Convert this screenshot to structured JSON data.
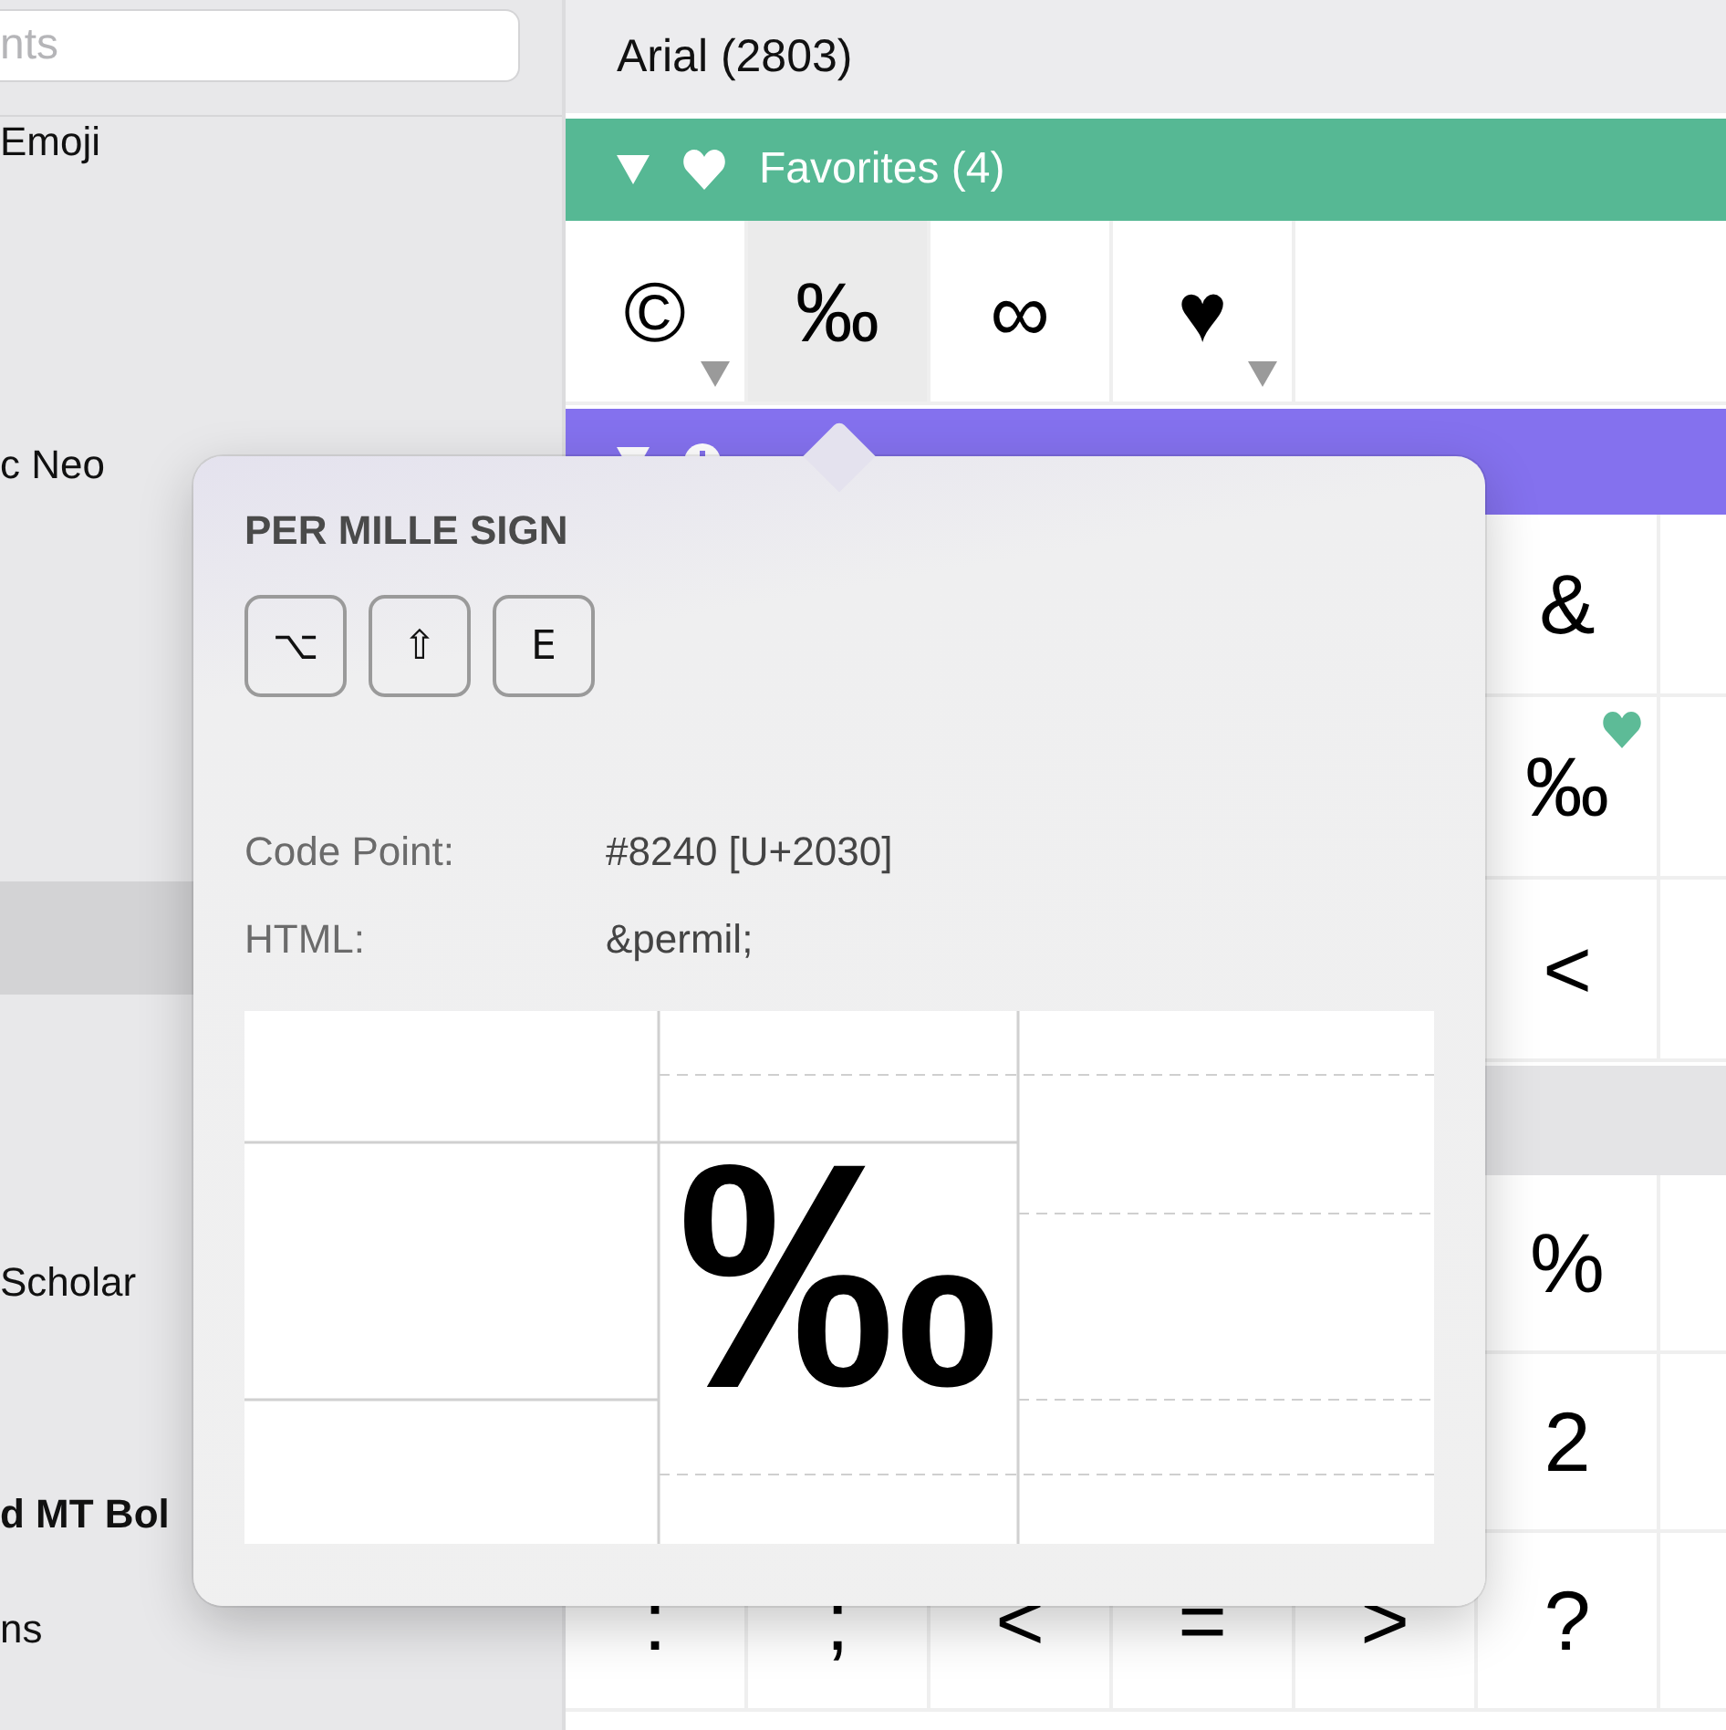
{
  "sidebar": {
    "search": {
      "placeholder": "nts"
    },
    "items": [
      {
        "label": "Emoji",
        "bold": false,
        "selected": false
      },
      {
        "label": "c Neo",
        "bold": false,
        "selected": false
      },
      {
        "selected": true
      },
      {
        "label": "Scholar",
        "bold": false,
        "selected": false
      },
      {
        "label": "d MT Bol",
        "bold": true,
        "selected": false
      },
      {
        "label": "ns",
        "bold": false,
        "selected": false
      }
    ]
  },
  "font_header": "Arial (2803)",
  "sections": [
    {
      "kind": "favorites",
      "title": "Favorites (4)",
      "expanded": true,
      "color": "#56b894",
      "rows": [
        [
          {
            "char": "©",
            "selected": false,
            "variants": true
          },
          {
            "char": "‰",
            "selected": true,
            "variants": false
          },
          {
            "char": "∞",
            "selected": false,
            "variants": false
          },
          {
            "char": "♥",
            "selected": false,
            "variants": true
          }
        ]
      ]
    },
    {
      "kind": "recent",
      "expanded": true,
      "color": "#8471ee",
      "rows": [
        [
          null,
          null,
          null,
          null,
          null,
          {
            "char": "&",
            "favorite": false
          }
        ],
        [
          null,
          null,
          null,
          null,
          null,
          {
            "char": "‰",
            "favorite": true
          }
        ],
        [
          null,
          null,
          null,
          null,
          null,
          {
            "char": "<",
            "favorite": false
          }
        ]
      ]
    },
    {
      "kind": "plain",
      "color": "#e4e4e6",
      "rows": [
        [
          null,
          null,
          null,
          null,
          null,
          {
            "char": "%",
            "favorite": false
          }
        ],
        [
          null,
          null,
          null,
          null,
          null,
          {
            "char": "2",
            "favorite": false
          }
        ],
        [
          {
            "char": ":"
          },
          {
            "char": ";"
          },
          {
            "char": "<"
          },
          {
            "char": "="
          },
          {
            "char": ">"
          },
          {
            "char": "?",
            "favorite": false
          }
        ]
      ]
    }
  ],
  "popover": {
    "title": "PER MILLE SIGN",
    "keys": [
      "⌥",
      "⇧",
      "E"
    ],
    "info": [
      {
        "label": "Code Point:",
        "value": "#8240 [U+2030]"
      },
      {
        "label": "HTML:",
        "value": "&permil;"
      }
    ],
    "preview": "‰"
  }
}
